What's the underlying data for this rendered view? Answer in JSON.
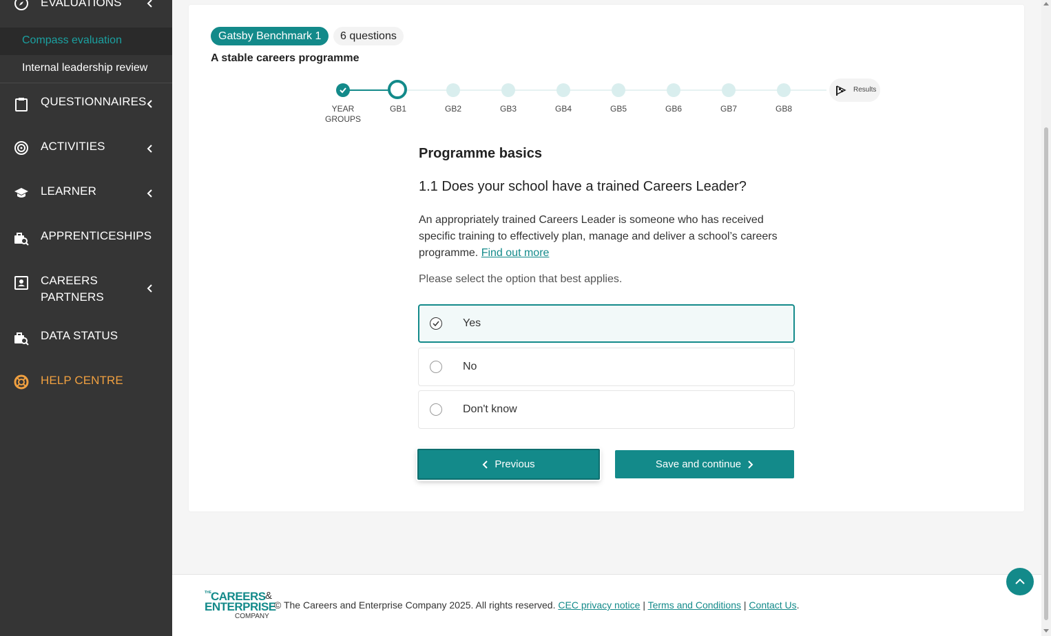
{
  "sidebar": {
    "evaluations_label": "EVALUATIONS",
    "sub_items": [
      "Compass evaluation",
      "Internal leadership review"
    ],
    "items": [
      {
        "label": "QUESTIONNAIRES",
        "icon": "clipboard-icon"
      },
      {
        "label": "ACTIVITIES",
        "icon": "target-icon"
      },
      {
        "label": "LEARNER",
        "icon": "graduation-cap-icon"
      },
      {
        "label": "APPRENTICESHIPS",
        "icon": "briefcase-search-icon"
      },
      {
        "label": "CAREERS",
        "label2": "PARTNERS",
        "icon": "contact-card-icon"
      },
      {
        "label": "DATA STATUS",
        "icon": "briefcase-search-icon"
      },
      {
        "label": "HELP CENTRE",
        "icon": "lifebuoy-icon",
        "color": "#f0a040"
      }
    ]
  },
  "header": {
    "badge": "Gatsby Benchmark 1",
    "question_count": "6 questions",
    "subtitle": "A stable careers programme"
  },
  "stepper": {
    "steps": [
      "YEAR",
      "GROUPS",
      "GB1",
      "GB2",
      "GB3",
      "GB4",
      "GB5",
      "GB6",
      "GB7",
      "GB8"
    ],
    "results_label": "Results",
    "current": "GB1",
    "completed": [
      "YEAR GROUPS"
    ]
  },
  "question": {
    "section_title": "Programme basics",
    "text": "1.1 Does your school have a trained Careers Leader?",
    "description": "An appropriately trained Careers Leader is someone who has received specific training to effectively plan, manage and deliver a school’s careers programme.",
    "find_out_more": "Find out more",
    "instruction": "Please select the option that best applies.",
    "options": [
      "Yes",
      "No",
      "Don't know"
    ],
    "selected": "Yes"
  },
  "buttons": {
    "previous": "Previous",
    "save_continue": "Save and continue"
  },
  "footer": {
    "logo_the": "THE",
    "logo_line1": "CAREERS",
    "logo_amp": "&",
    "logo_line2": "ENTERPRISE",
    "logo_line3": "COMPANY",
    "copyright": "© The Careers and Enterprise Company 2025. All rights reserved.",
    "privacy": "CEC privacy notice",
    "sep": "|",
    "terms": "Terms and Conditions",
    "contact": "Contact Us",
    "end": "."
  },
  "colors": {
    "accent": "#138a8a",
    "sidebar_bg": "#353535",
    "help_centre": "#f0a040"
  }
}
